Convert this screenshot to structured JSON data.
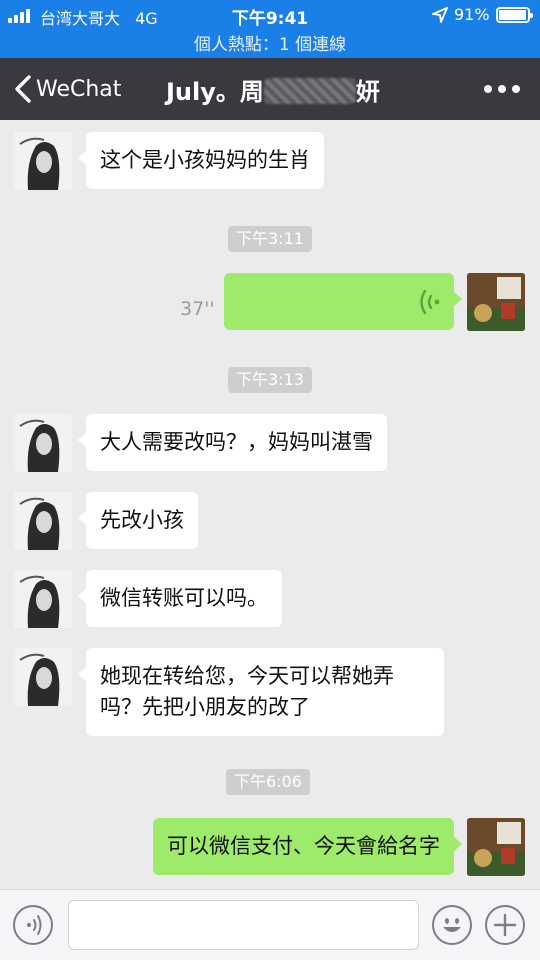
{
  "status_bar": {
    "carrier": "台湾大哥大",
    "network": "4G",
    "time": "下午9:41",
    "battery": "91%",
    "battery_level": 0.91,
    "hotspot": "個人熱點：1 個連線"
  },
  "nav": {
    "back_label": "WeChat",
    "title_start": "July。周",
    "title_end": "妍",
    "more_icon": "more-dots-icon"
  },
  "messages": [
    {
      "side": "in",
      "text": "这个是小孩妈妈的生肖"
    },
    {
      "type": "time",
      "text": "下午3:11"
    },
    {
      "side": "out",
      "type": "voice",
      "duration": "37''"
    },
    {
      "type": "time",
      "text": "下午3:13"
    },
    {
      "side": "in",
      "text": "大人需要改吗？，妈妈叫湛雪"
    },
    {
      "side": "in",
      "text": "先改小孩"
    },
    {
      "side": "in",
      "text": "微信转账可以吗。"
    },
    {
      "side": "in",
      "text": "她现在转给您，今天可以帮她弄吗？先把小朋友的改了"
    },
    {
      "type": "time",
      "text": "下午6:06"
    },
    {
      "side": "out",
      "text": "可以微信支付、今天會給名字"
    }
  ],
  "input_bar": {
    "voice_icon": "voice-icon",
    "emoji_icon": "emoji-icon",
    "plus_icon": "plus-icon"
  },
  "colors": {
    "status_bar": "#1a7fe6",
    "nav_bar": "#393a3f",
    "chat_bg": "#ebebeb",
    "bubble_out": "#9eea6a",
    "bubble_in": "#ffffff"
  }
}
